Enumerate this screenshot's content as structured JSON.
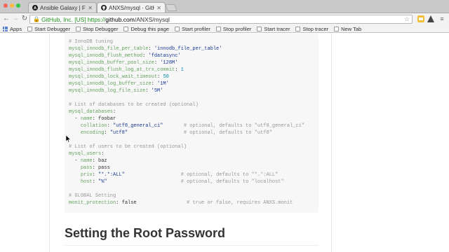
{
  "window": {
    "dot_colors": [
      "#fc605c",
      "#fdbc40",
      "#34c84a"
    ]
  },
  "tabs": [
    {
      "title": "Ansible Galaxy | Find, reus",
      "favicon": "ansible-icon",
      "active": false
    },
    {
      "title": "ANXS/mysql · GitHub",
      "favicon": "github-icon",
      "active": true
    }
  ],
  "address_bar": {
    "ev_label": "GitHub, Inc. [US]",
    "scheme": "https://",
    "host": "github.com",
    "path": "/ANXS/mysql"
  },
  "bookmarks": [
    {
      "label": "Apps",
      "icon": "apps-grid-icon"
    },
    {
      "label": "Start Debugger",
      "icon": "page-icon"
    },
    {
      "label": "Stop Debugger",
      "icon": "page-icon"
    },
    {
      "label": "Debug this page",
      "icon": "page-icon"
    },
    {
      "label": "Start profiler",
      "icon": "page-icon"
    },
    {
      "label": "Stop profiler",
      "icon": "page-icon"
    },
    {
      "label": "Start tracer",
      "icon": "page-icon"
    },
    {
      "label": "Stop tracer",
      "icon": "page-icon"
    },
    {
      "label": "New Tab",
      "icon": "page-icon"
    }
  ],
  "code": {
    "lines": [
      [
        [
          "c-comment",
          "# InnoDB tuning"
        ]
      ],
      [
        [
          "c-key2",
          "mysql_innodb_file_per_table"
        ],
        [
          "c-plain",
          ": "
        ],
        [
          "c-str",
          "'innodb_file_per_table'"
        ]
      ],
      [
        [
          "c-key2",
          "mysql_innodb_flush_method"
        ],
        [
          "c-plain",
          ": "
        ],
        [
          "c-str",
          "'fdatasync'"
        ]
      ],
      [
        [
          "c-key2",
          "mysql_innodb_buffer_pool_size"
        ],
        [
          "c-plain",
          ": "
        ],
        [
          "c-str",
          "'128M'"
        ]
      ],
      [
        [
          "c-key2",
          "mysql_innodb_flush_log_at_trx_commit"
        ],
        [
          "c-plain",
          ": "
        ],
        [
          "c-num",
          "1"
        ]
      ],
      [
        [
          "c-key2",
          "mysql_innodb_lock_wait_timeout"
        ],
        [
          "c-plain",
          ": "
        ],
        [
          "c-num",
          "50"
        ]
      ],
      [
        [
          "c-key2",
          "mysql_innodb_log_buffer_size"
        ],
        [
          "c-plain",
          ": "
        ],
        [
          "c-str",
          "'1M'"
        ]
      ],
      [
        [
          "c-key2",
          "mysql_innodb_log_file_size"
        ],
        [
          "c-plain",
          ": "
        ],
        [
          "c-str",
          "'5M'"
        ]
      ],
      [],
      [
        [
          "c-comment",
          "# List of databases to be created (optional)"
        ]
      ],
      [
        [
          "c-key2",
          "mysql_databases"
        ],
        [
          "c-plain",
          ":"
        ]
      ],
      [
        [
          "c-dash",
          "  - "
        ],
        [
          "c-key2",
          "name"
        ],
        [
          "c-plain",
          ": foobar"
        ]
      ],
      [
        [
          "c-plain",
          "    "
        ],
        [
          "c-key2",
          "collation"
        ],
        [
          "c-plain",
          ": "
        ],
        [
          "c-str",
          "\"utf8_general_ci\""
        ],
        [
          "c-plain",
          "       "
        ],
        [
          "c-comment",
          "# optional, defaults to \"utf8_general_ci\""
        ]
      ],
      [
        [
          "c-plain",
          "    "
        ],
        [
          "c-key2",
          "encoding"
        ],
        [
          "c-plain",
          ": "
        ],
        [
          "c-str",
          "\"utf8\""
        ],
        [
          "c-plain",
          "                   "
        ],
        [
          "c-comment",
          "# optional, defaults to \"utf8\""
        ]
      ],
      [],
      [
        [
          "c-comment",
          "# List of users to be created (optional)"
        ]
      ],
      [
        [
          "c-key2",
          "mysql_users"
        ],
        [
          "c-plain",
          ":"
        ]
      ],
      [
        [
          "c-dash",
          "  - "
        ],
        [
          "c-key2",
          "name"
        ],
        [
          "c-plain",
          ": baz"
        ]
      ],
      [
        [
          "c-plain",
          "    "
        ],
        [
          "c-key2",
          "pass"
        ],
        [
          "c-plain",
          ": pass"
        ]
      ],
      [
        [
          "c-plain",
          "    "
        ],
        [
          "c-key2",
          "priv"
        ],
        [
          "c-plain",
          ": "
        ],
        [
          "c-str",
          "\"*.*:ALL\""
        ],
        [
          "c-plain",
          "                   "
        ],
        [
          "c-comment",
          "# optional, defaults to \"*.*:ALL\""
        ]
      ],
      [
        [
          "c-plain",
          "    "
        ],
        [
          "c-key2",
          "host"
        ],
        [
          "c-plain",
          ": "
        ],
        [
          "c-str",
          "\"%\""
        ],
        [
          "c-plain",
          "                         "
        ],
        [
          "c-comment",
          "# optional, defaults to \"localhost\""
        ]
      ],
      [],
      [
        [
          "c-comment",
          "# GLOBAL Setting"
        ]
      ],
      [
        [
          "c-key2",
          "monit_protection"
        ],
        [
          "c-plain",
          ": false"
        ],
        [
          "c-plain",
          "                 "
        ],
        [
          "c-comment",
          "# true or false, requires ANXS.monit"
        ]
      ]
    ]
  },
  "section_heading": "Setting the Root Password"
}
